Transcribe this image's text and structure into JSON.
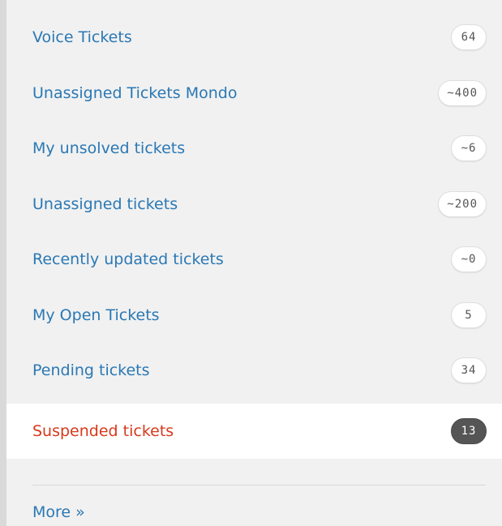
{
  "views": [
    {
      "label": "Voice Tickets",
      "count": "64"
    },
    {
      "label": "Unassigned Tickets Mondo",
      "count": "~400"
    },
    {
      "label": "My unsolved tickets",
      "count": "~6"
    },
    {
      "label": "Unassigned tickets",
      "count": "~200"
    },
    {
      "label": "Recently updated tickets",
      "count": "~0"
    },
    {
      "label": "My Open Tickets",
      "count": "5"
    },
    {
      "label": "Pending tickets",
      "count": "34"
    },
    {
      "label": "Suspended tickets",
      "count": "13",
      "selected": true
    }
  ],
  "more_link": "More »",
  "colors": {
    "link": "#2a78b4",
    "selected_link": "#d6391c",
    "selected_badge": "#555555",
    "panel_background": "#f1f1f1"
  }
}
